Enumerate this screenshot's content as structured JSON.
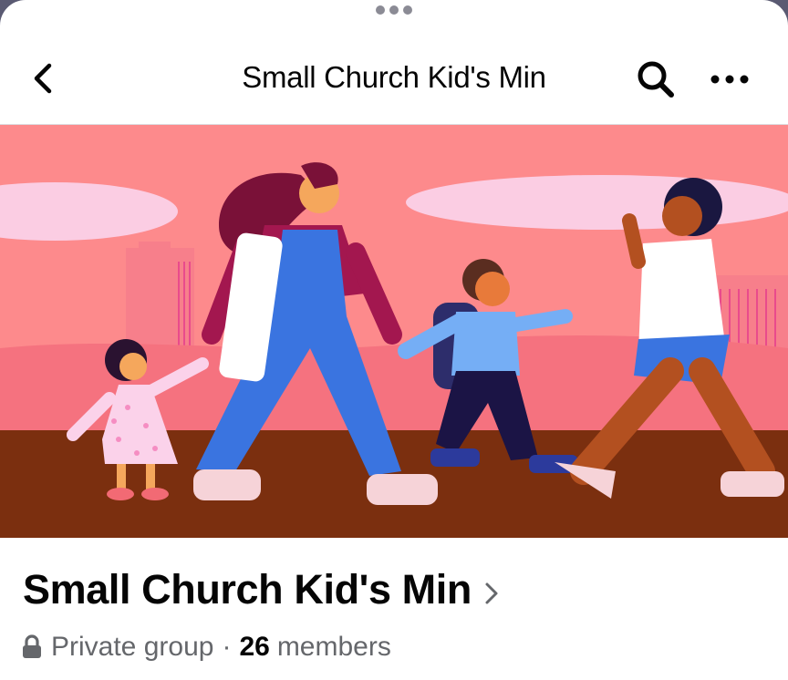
{
  "navbar": {
    "title": "Small Church Kid's Min",
    "back_icon": "chevron-left-icon",
    "search_icon": "search-icon",
    "more_icon": "more-horizontal-icon"
  },
  "cover": {
    "colors": {
      "sky": "#fd8a8c",
      "ground": "#7b2f0f",
      "cloud": "#fbcde3"
    }
  },
  "group": {
    "name": "Small Church Kid's Min",
    "privacy_label": "Private group",
    "separator": "·",
    "member_count": "26",
    "members_label": "members"
  }
}
